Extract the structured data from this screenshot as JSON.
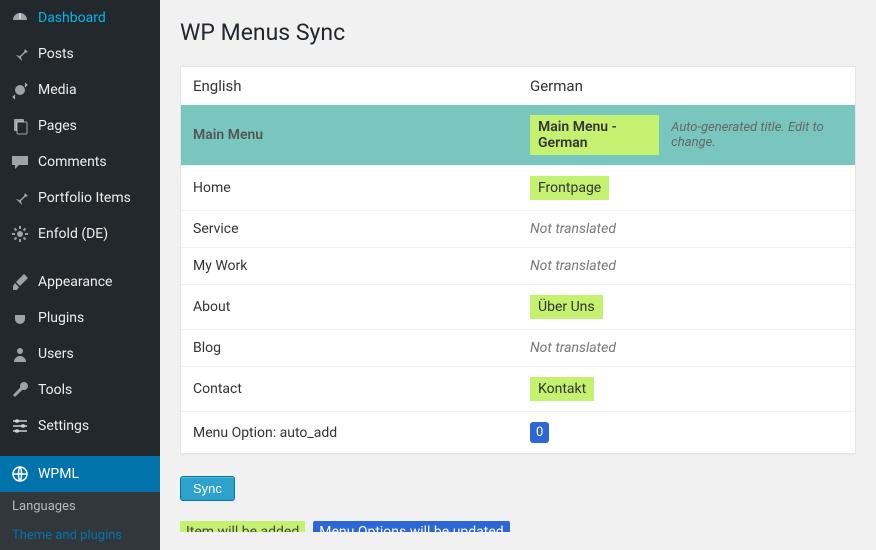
{
  "sidebar": {
    "items": [
      {
        "label": "Dashboard",
        "icon": "dashboard"
      },
      {
        "label": "Posts",
        "icon": "pin"
      },
      {
        "label": "Media",
        "icon": "media"
      },
      {
        "label": "Pages",
        "icon": "pages"
      },
      {
        "label": "Comments",
        "icon": "comment"
      },
      {
        "label": "Portfolio Items",
        "icon": "pin"
      },
      {
        "label": "Enfold (DE)",
        "icon": "gear"
      },
      {
        "label": "Appearance",
        "icon": "brush"
      },
      {
        "label": "Plugins",
        "icon": "plug"
      },
      {
        "label": "Users",
        "icon": "user"
      },
      {
        "label": "Tools",
        "icon": "wrench"
      },
      {
        "label": "Settings",
        "icon": "sliders"
      },
      {
        "label": "WPML",
        "icon": "globe"
      }
    ],
    "sub": [
      {
        "label": "Languages"
      },
      {
        "label": "Theme and plugins"
      }
    ]
  },
  "page": {
    "title": "WP Menus Sync",
    "col_source": "English",
    "col_target": "German",
    "menu_name": "Main Menu",
    "menu_name_target": "Main Menu - German",
    "menu_hint": "Auto-generated title. Edit to change.",
    "rows": [
      {
        "src": "Home",
        "tgt": "Frontpage",
        "kind": "green"
      },
      {
        "src": "Service",
        "tgt": "Not translated",
        "kind": "nt"
      },
      {
        "src": "My Work",
        "tgt": "Not translated",
        "kind": "nt"
      },
      {
        "src": "About",
        "tgt": "Über Uns",
        "kind": "green"
      },
      {
        "src": "Blog",
        "tgt": "Not translated",
        "kind": "nt"
      },
      {
        "src": "Contact",
        "tgt": "Kontakt",
        "kind": "green"
      }
    ],
    "option_label": "Menu Option: auto_add",
    "option_value": "0",
    "sync_label": "Sync",
    "legend_added": "Item will be added",
    "legend_updated": "Menu Options will be updated"
  }
}
